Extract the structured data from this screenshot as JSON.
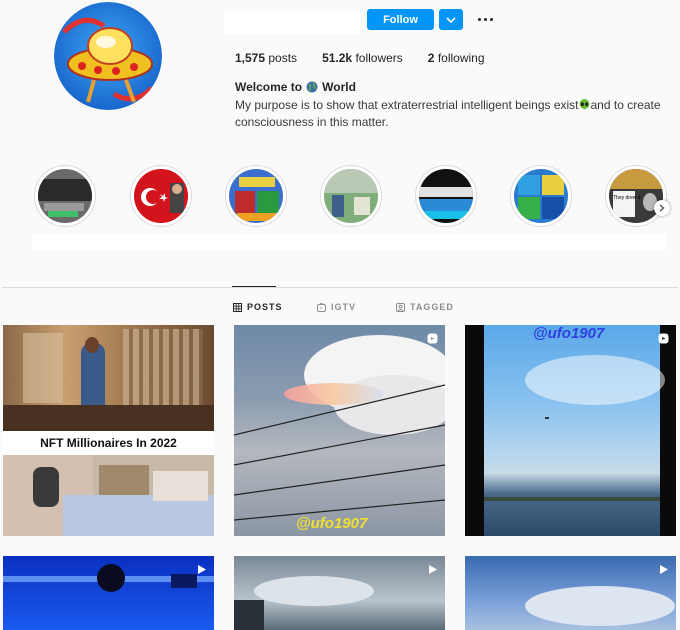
{
  "profile": {
    "follow_label": "Follow",
    "stats": {
      "posts": "1,575",
      "posts_label": "posts",
      "followers": "51.2k",
      "followers_label": "followers",
      "following": "2",
      "following_label": "following"
    },
    "bio_title_pre": "Welcome to",
    "bio_title_post": "World",
    "bio_line_pre": "My purpose is to show that extraterrestrial intelligent beings exist",
    "bio_line_post": "and to create consciousness in this matter."
  },
  "highlights": [
    {
      "name": "dark-scene"
    },
    {
      "name": "turkish-flag"
    },
    {
      "name": "colorful-collage"
    },
    {
      "name": "green-video"
    },
    {
      "name": "blue-screen"
    },
    {
      "name": "map-collage"
    },
    {
      "name": "they-drew-it",
      "caption": "They drew it"
    }
  ],
  "tabs": [
    {
      "label": "POSTS",
      "icon": "grid-icon",
      "active": true
    },
    {
      "label": "IGTV",
      "icon": "igtv-icon",
      "active": false
    },
    {
      "label": "TAGGED",
      "icon": "tagged-icon",
      "active": false
    }
  ],
  "posts": [
    {
      "type": "image",
      "caption": "NFT Millionaires In 2022"
    },
    {
      "type": "video",
      "watermark": "@ufo1907"
    },
    {
      "type": "video",
      "watermark": "@ufo1907"
    },
    {
      "type": "video"
    },
    {
      "type": "video"
    },
    {
      "type": "video"
    }
  ],
  "colors": {
    "accent": "#0095f6",
    "text": "#262626",
    "muted": "#8e8e8e",
    "border": "#dbdbdb",
    "background": "#fafafa"
  }
}
